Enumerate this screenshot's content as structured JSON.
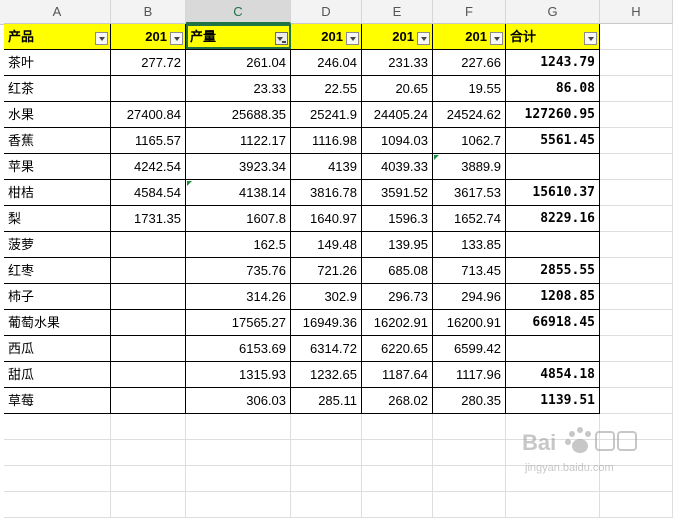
{
  "columns": [
    "A",
    "B",
    "C",
    "D",
    "E",
    "F",
    "G",
    "H"
  ],
  "header": {
    "product": "产品",
    "b": "201",
    "c": "产量",
    "d": "201",
    "e": "201",
    "f": "201",
    "g": "合计"
  },
  "rows": [
    {
      "name": "茶叶",
      "b": "277.72",
      "c": "261.04",
      "d": "246.04",
      "e": "231.33",
      "f": "227.66",
      "g": "1243.79"
    },
    {
      "name": "红茶",
      "b": "",
      "c": "23.33",
      "d": "22.55",
      "e": "20.65",
      "f": "19.55",
      "g": "86.08"
    },
    {
      "name": "水果",
      "b": "27400.84",
      "c": "25688.35",
      "d": "25241.9",
      "e": "24405.24",
      "f": "24524.62",
      "g": "127260.95"
    },
    {
      "name": "香蕉",
      "b": "1165.57",
      "c": "1122.17",
      "d": "1116.98",
      "e": "1094.03",
      "f": "1062.7",
      "g": "5561.45"
    },
    {
      "name": "苹果",
      "b": "4242.54",
      "c": "3923.34",
      "d": "4139",
      "e": "4039.33",
      "f": "3889.9",
      "g": ""
    },
    {
      "name": "柑桔",
      "b": "4584.54",
      "c": "4138.14",
      "d": "3816.78",
      "e": "3591.52",
      "f": "3617.53",
      "g": "15610.37"
    },
    {
      "name": "梨",
      "b": "1731.35",
      "c": "1607.8",
      "d": "1640.97",
      "e": "1596.3",
      "f": "1652.74",
      "g": "8229.16"
    },
    {
      "name": "菠萝",
      "b": "",
      "c": "162.5",
      "d": "149.48",
      "e": "139.95",
      "f": "133.85",
      "g": ""
    },
    {
      "name": "红枣",
      "b": "",
      "c": "735.76",
      "d": "721.26",
      "e": "685.08",
      "f": "713.45",
      "g": "2855.55"
    },
    {
      "name": "柿子",
      "b": "",
      "c": "314.26",
      "d": "302.9",
      "e": "296.73",
      "f": "294.96",
      "g": "1208.85"
    },
    {
      "name": "葡萄水果",
      "b": "",
      "c": "17565.27",
      "d": "16949.36",
      "e": "16202.91",
      "f": "16200.91",
      "g": "66918.45"
    },
    {
      "name": "西瓜",
      "b": "",
      "c": "6153.69",
      "d": "6314.72",
      "e": "6220.65",
      "f": "6599.42",
      "g": ""
    },
    {
      "name": "甜瓜",
      "b": "",
      "c": "1315.93",
      "d": "1232.65",
      "e": "1187.64",
      "f": "1117.96",
      "g": "4854.18"
    },
    {
      "name": "草莓",
      "b": "",
      "c": "306.03",
      "d": "285.11",
      "e": "268.02",
      "f": "280.35",
      "g": "1139.51"
    }
  ],
  "watermark": {
    "text": "jingyan.baidu.com"
  }
}
